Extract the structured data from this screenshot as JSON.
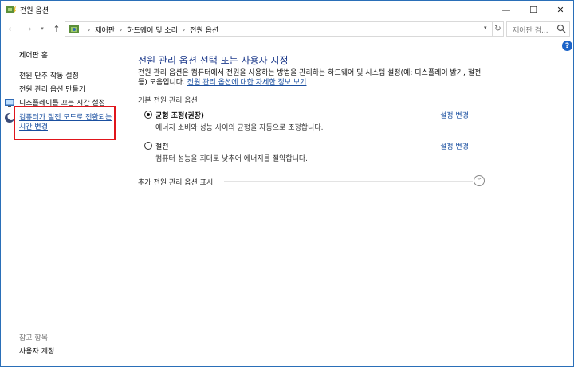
{
  "window": {
    "title": "전원 옵션",
    "controls": {
      "minimize": "—",
      "maximize": "☐",
      "close": "✕"
    }
  },
  "address_bar": {
    "back": "←",
    "forward": "→",
    "up": "↑",
    "breadcrumbs": [
      "제어판",
      "하드웨어 및 소리",
      "전원 옵션"
    ],
    "separator": "›",
    "refresh": "↻",
    "search_placeholder": "제어판 검..."
  },
  "help": "?",
  "sidebar": {
    "home": "제어판 홈",
    "links": [
      "전원 단추 작동 설정",
      "전원 관리 옵션 만들기",
      "디스플레이를 끄는 시간 설정",
      "컴퓨터가 절전 모드로 전환되는 시간 변경"
    ],
    "see_also": "참고 항목",
    "user_accounts": "사용자 계정"
  },
  "main": {
    "title": "전원 관리 옵션 선택 또는 사용자 지정",
    "description": "전원 관리 옵션은 컴퓨터에서 전원을 사용하는 방법을 관리하는 하드웨어 및 시스템 설정(예: 디스플레이 밝기, 절전 등) 모음입니다.",
    "description_link": "전원 관리 옵션에 대한 자세한 정보 보기",
    "section_header": "기본 전원 관리 옵션",
    "plans": [
      {
        "name": "균형 조정(권장)",
        "description": "에너지 소비와 성능 사이의 균형을 자동으로 조정합니다.",
        "change": "설정 변경",
        "selected": true
      },
      {
        "name": "절전",
        "description": "컴퓨터 성능을 최대로 낮추어 에너지를 절약합니다.",
        "change": "설정 변경",
        "selected": false
      }
    ],
    "more_plans": "추가 전원 관리 옵션 표시"
  },
  "colors": {
    "link": "#1a4fa0",
    "title": "#1e3b8c",
    "highlight": "#e0151b",
    "help": "#1c64c8"
  }
}
